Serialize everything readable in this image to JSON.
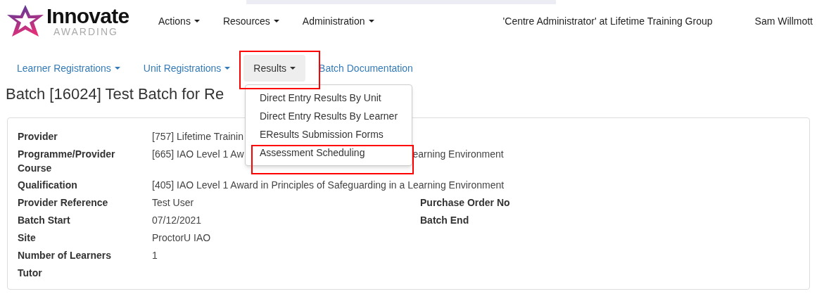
{
  "header": {
    "logo": {
      "name": "Innovate",
      "tagline": "AWARDING"
    },
    "menu": [
      {
        "label": "Actions"
      },
      {
        "label": "Resources"
      },
      {
        "label": "Administration"
      }
    ],
    "role": "'Centre Administrator' at Lifetime Training Group",
    "user": "Sam Willmott"
  },
  "subnav": [
    {
      "label": "Learner Registrations",
      "kind": "dropdown",
      "selected": false
    },
    {
      "label": "Unit Registrations",
      "kind": "dropdown",
      "selected": false
    },
    {
      "label": "Results",
      "kind": "dropdown",
      "selected": true
    },
    {
      "label": "Batch Documentation",
      "kind": "link",
      "selected": false
    }
  ],
  "dropdown_menu": {
    "items": [
      {
        "label": "Direct Entry Results By Unit"
      },
      {
        "label": "Direct Entry Results By Learner"
      },
      {
        "label": "EResults Submission Forms"
      },
      {
        "label": "Assessment Scheduling"
      }
    ]
  },
  "title": "Batch [16024] Test Batch for Re",
  "details": [
    {
      "label": "Provider",
      "value": "[757] Lifetime Trainin"
    },
    {
      "label": "Programme/Provider Course",
      "value": "[665] IAO Level 1 Aw",
      "value_end": "earning Environment"
    },
    {
      "label": "Qualification",
      "value": "[405] IAO Level 1 Award in Principles of Safeguarding in a Learning Environment"
    },
    {
      "label": "Provider Reference",
      "value": "Test User",
      "side_label": "Purchase Order No"
    },
    {
      "label": "Batch Start",
      "value": "07/12/2021",
      "side_label": "Batch End"
    },
    {
      "label": "Site",
      "value": "ProctorU IAO"
    },
    {
      "label": "Number of Learners",
      "value": "1"
    },
    {
      "label": "Tutor"
    }
  ]
}
